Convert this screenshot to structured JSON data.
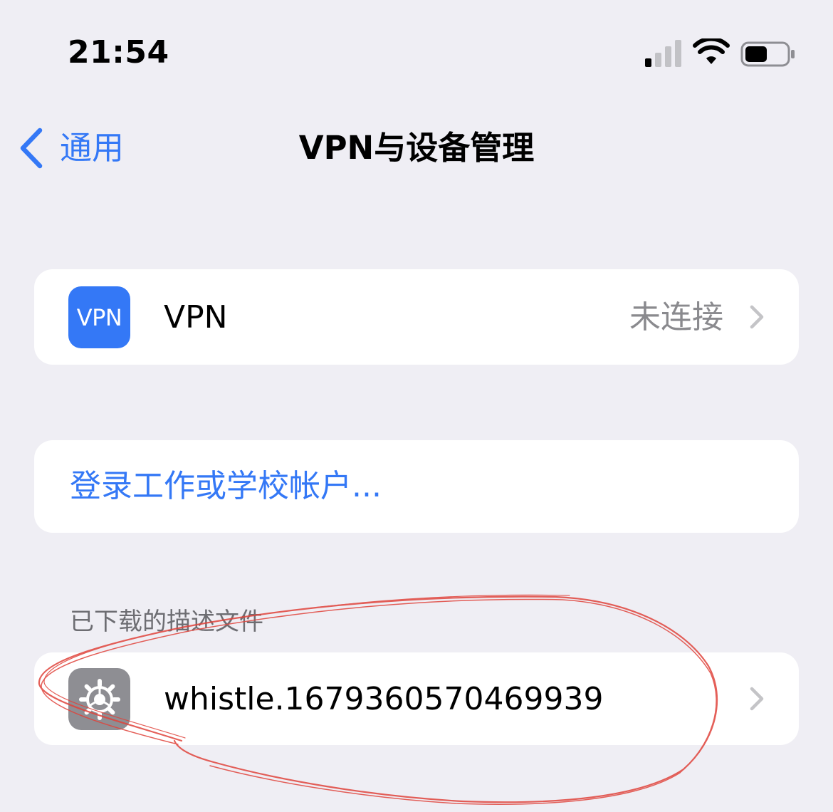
{
  "status_bar": {
    "time": "21:54",
    "signal_bars_active": 1,
    "signal_bars_total": 4,
    "battery_level": 0.4
  },
  "nav": {
    "back_label": "通用",
    "title": "VPN与设备管理"
  },
  "vpn_row": {
    "icon_text": "VPN",
    "label": "VPN",
    "status": "未连接"
  },
  "login_row": {
    "label": "登录工作或学校帐户..."
  },
  "profiles_section": {
    "header": "已下载的描述文件",
    "items": [
      {
        "label": "whistle.16793605704699​39",
        "icon": "settings-gear-icon"
      }
    ]
  },
  "annotation": {
    "type": "freehand-circle",
    "color": "#e0443c"
  },
  "colors": {
    "accent": "#3478f6",
    "background": "#efeef4",
    "card": "#ffffff",
    "secondary_text": "#8a8a8e",
    "section_header": "#6d6d72"
  }
}
